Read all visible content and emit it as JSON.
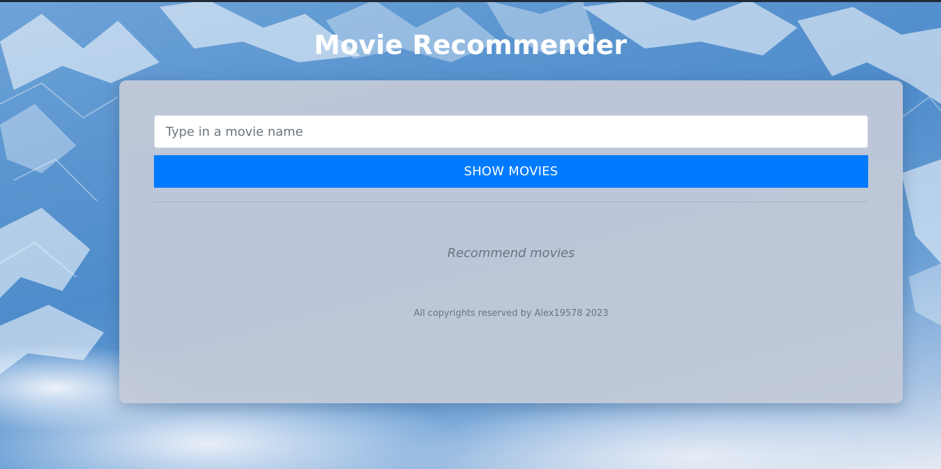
{
  "header": {
    "title": "Movie Recommender"
  },
  "search": {
    "placeholder": "Type in a movie name",
    "value": ""
  },
  "actions": {
    "show_movies_label": "SHOW MOVIES"
  },
  "results": {
    "placeholder_text": "Recommend movies"
  },
  "footer": {
    "copyright": "All copyrights reserved by Alex19578 2023"
  },
  "colors": {
    "accent": "#007bff",
    "card_background": "#c4cad8",
    "title_text": "#ffffff",
    "muted_text": "#6b7380"
  }
}
